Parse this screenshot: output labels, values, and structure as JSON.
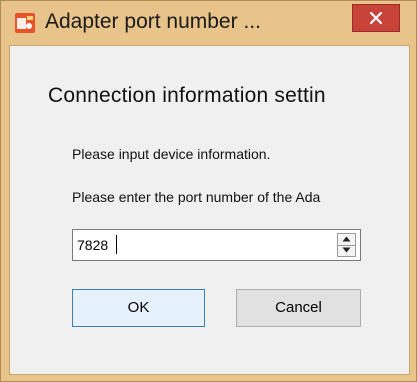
{
  "window": {
    "title": "Adapter port number ..."
  },
  "dialog": {
    "heading": "Connection information settin",
    "instruction": "Please input device information.",
    "prompt": "Please enter the port number of the Ada",
    "port_value": "7828"
  },
  "buttons": {
    "ok_label": "OK",
    "cancel_label": "Cancel"
  },
  "icons": {
    "app": "app-icon",
    "close": "close-icon",
    "spin_up": "arrow-up-icon",
    "spin_down": "arrow-down-icon"
  },
  "colors": {
    "frame": "#e8c48a",
    "close_button": "#c8433a",
    "client_background": "#f0f0f0",
    "ok_border": "#3c7fb1"
  }
}
